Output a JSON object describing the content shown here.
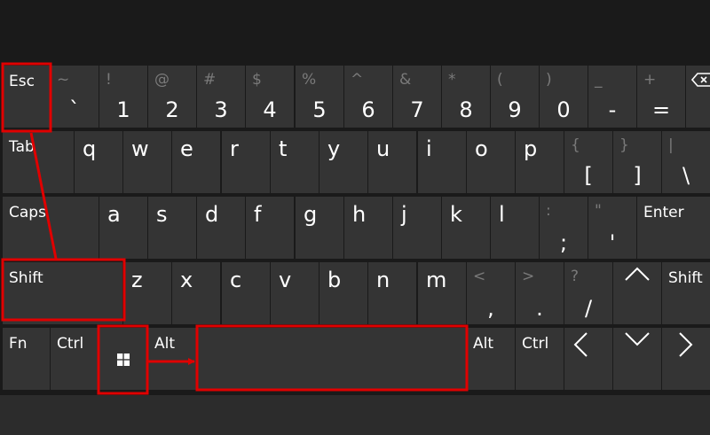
{
  "rows": [
    [
      {
        "id": "esc",
        "label": "Esc",
        "type": "text"
      },
      {
        "id": "backtick",
        "shift": "~",
        "main": "`",
        "type": "num"
      },
      {
        "id": "1",
        "shift": "!",
        "main": "1",
        "type": "num"
      },
      {
        "id": "2",
        "shift": "@",
        "main": "2",
        "type": "num"
      },
      {
        "id": "3",
        "shift": "#",
        "main": "3",
        "type": "num"
      },
      {
        "id": "4",
        "shift": "$",
        "main": "4",
        "type": "num"
      },
      {
        "id": "5",
        "shift": "%",
        "main": "5",
        "type": "num"
      },
      {
        "id": "6",
        "shift": "^",
        "main": "6",
        "type": "num"
      },
      {
        "id": "7",
        "shift": "&",
        "main": "7",
        "type": "num"
      },
      {
        "id": "8",
        "shift": "*",
        "main": "8",
        "type": "num"
      },
      {
        "id": "9",
        "shift": "(",
        "main": "9",
        "type": "num"
      },
      {
        "id": "0",
        "shift": ")",
        "main": "0",
        "type": "num"
      },
      {
        "id": "minus",
        "shift": "_",
        "main": "-",
        "type": "num"
      },
      {
        "id": "equals",
        "shift": "+",
        "main": "=",
        "type": "num"
      },
      {
        "id": "backspace",
        "icon": "backspace-icon",
        "type": "icon"
      }
    ],
    [
      {
        "id": "tab",
        "label": "Tab",
        "type": "text"
      },
      {
        "id": "q",
        "main": "q",
        "type": "letter"
      },
      {
        "id": "w",
        "main": "w",
        "type": "letter"
      },
      {
        "id": "e",
        "main": "e",
        "type": "letter"
      },
      {
        "id": "r",
        "main": "r",
        "type": "letter"
      },
      {
        "id": "t",
        "main": "t",
        "type": "letter"
      },
      {
        "id": "y",
        "main": "y",
        "type": "letter"
      },
      {
        "id": "u",
        "main": "u",
        "type": "letter"
      },
      {
        "id": "i",
        "main": "i",
        "type": "letter"
      },
      {
        "id": "o",
        "main": "o",
        "type": "letter"
      },
      {
        "id": "p",
        "main": "p",
        "type": "letter"
      },
      {
        "id": "lbracket",
        "shift": "{",
        "main": "[",
        "type": "num"
      },
      {
        "id": "rbracket",
        "shift": "}",
        "main": "]",
        "type": "num"
      },
      {
        "id": "backslash",
        "shift": "|",
        "main": "\\",
        "type": "num"
      }
    ],
    [
      {
        "id": "caps",
        "label": "Caps",
        "type": "text"
      },
      {
        "id": "a",
        "main": "a",
        "type": "letter"
      },
      {
        "id": "s",
        "main": "s",
        "type": "letter"
      },
      {
        "id": "d",
        "main": "d",
        "type": "letter"
      },
      {
        "id": "f",
        "main": "f",
        "type": "letter"
      },
      {
        "id": "g",
        "main": "g",
        "type": "letter"
      },
      {
        "id": "h",
        "main": "h",
        "type": "letter"
      },
      {
        "id": "j",
        "main": "j",
        "type": "letter"
      },
      {
        "id": "k",
        "main": "k",
        "type": "letter"
      },
      {
        "id": "l",
        "main": "l",
        "type": "letter"
      },
      {
        "id": "semicolon",
        "shift": ":",
        "main": ";",
        "type": "punct"
      },
      {
        "id": "quote",
        "shift": "\"",
        "main": "'",
        "type": "punct"
      },
      {
        "id": "enter",
        "label": "Enter",
        "type": "text"
      }
    ],
    [
      {
        "id": "lshift",
        "label": "Shift",
        "type": "text"
      },
      {
        "id": "z",
        "main": "z",
        "type": "letter"
      },
      {
        "id": "x",
        "main": "x",
        "type": "letter"
      },
      {
        "id": "c",
        "main": "c",
        "type": "letter"
      },
      {
        "id": "v",
        "main": "v",
        "type": "letter"
      },
      {
        "id": "b",
        "main": "b",
        "type": "letter"
      },
      {
        "id": "n",
        "main": "n",
        "type": "letter"
      },
      {
        "id": "m",
        "main": "m",
        "type": "letter"
      },
      {
        "id": "comma",
        "shift": "<",
        "main": ",",
        "type": "punct"
      },
      {
        "id": "period",
        "shift": ">",
        "main": ".",
        "type": "punct"
      },
      {
        "id": "slash",
        "shift": "?",
        "main": "/",
        "type": "punct"
      },
      {
        "id": "up",
        "icon": "chevron-up-icon",
        "type": "icon"
      },
      {
        "id": "rshift",
        "label": "Shift",
        "type": "text"
      }
    ],
    [
      {
        "id": "fn",
        "label": "Fn",
        "type": "text"
      },
      {
        "id": "lctrl",
        "label": "Ctrl",
        "type": "text"
      },
      {
        "id": "win",
        "icon": "windows-logo-icon",
        "type": "icon"
      },
      {
        "id": "lalt",
        "label": "Alt",
        "type": "text"
      },
      {
        "id": "space",
        "type": "blank"
      },
      {
        "id": "ralt",
        "label": "Alt",
        "type": "text"
      },
      {
        "id": "rctrl",
        "label": "Ctrl",
        "type": "text"
      },
      {
        "id": "left",
        "icon": "chevron-left-icon",
        "type": "icon"
      },
      {
        "id": "down",
        "icon": "chevron-down-icon",
        "type": "icon"
      },
      {
        "id": "right",
        "icon": "chevron-right-icon",
        "type": "icon"
      }
    ]
  ],
  "highlighted_keys": [
    "esc",
    "lshift",
    "win",
    "space"
  ],
  "colors": {
    "key_bg": "#343434",
    "page_bg": "#1a1a1a",
    "key_text": "#ffffff",
    "shift_text": "#7a7a7a",
    "highlight": "#e00000"
  }
}
